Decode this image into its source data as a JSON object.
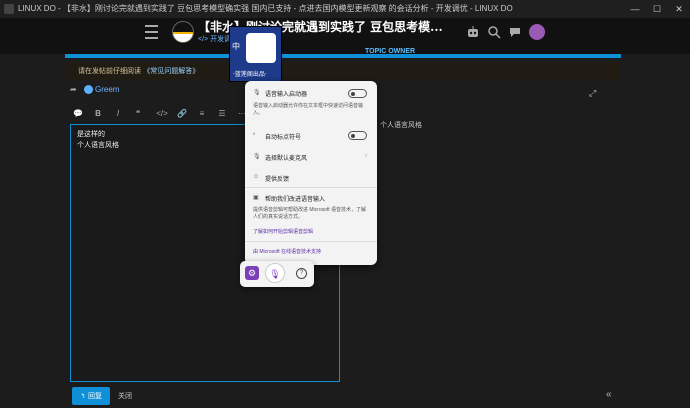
{
  "window": {
    "title": "LINUX DO - 【非水】刚讨论完就遇到实践了 豆包思考模型确实强 国内已支持 - 点进去国内模型更新观察 的会话分析 - 开发调优 - LINUX DO",
    "minimize": "—",
    "maximize": "☐",
    "close": "✕"
  },
  "header": {
    "site_title": "【非水】刚讨论完就遇到实践了 豆包思考模...",
    "subtitle": "</> 开发调优",
    "topic_owner": "TOPIC OWNER"
  },
  "notice": {
    "text": "请在发帖前仔细阅读",
    "link": "《常见问题解答》"
  },
  "composer": {
    "reply_to": "Greem",
    "body_line1": "是这样的",
    "body_line2": "个人语言风格",
    "preview_line": "个人语言风格",
    "reply_label": "回复",
    "close_label": "关闭"
  },
  "toolbar": [
    "💬",
    "B",
    "I",
    "❝",
    "</>",
    "🔗",
    "≡",
    "☰",
    "⋯"
  ],
  "ime": {
    "mode_char": "中",
    "caption": "·蓝莲阁出品·"
  },
  "voice_panel": {
    "launcher_label": "语音输入启动器",
    "launcher_desc": "语音输入启动器允许你在文本框中快速访问语音输入。",
    "punct_label": "自动标点符号",
    "mic_label": "选择默认麦克风",
    "feedback_label": "提供反馈",
    "improve_label": "帮助我们改进语音输入",
    "improve_desc": "提供语音剪辑可帮助改进 Microsoft 语音技术，了解人们的真实说话方式。",
    "learn_link": "了解如何开始剪辑语音剪辑",
    "footer": "由 Microsoft 在线语音技术支持"
  }
}
